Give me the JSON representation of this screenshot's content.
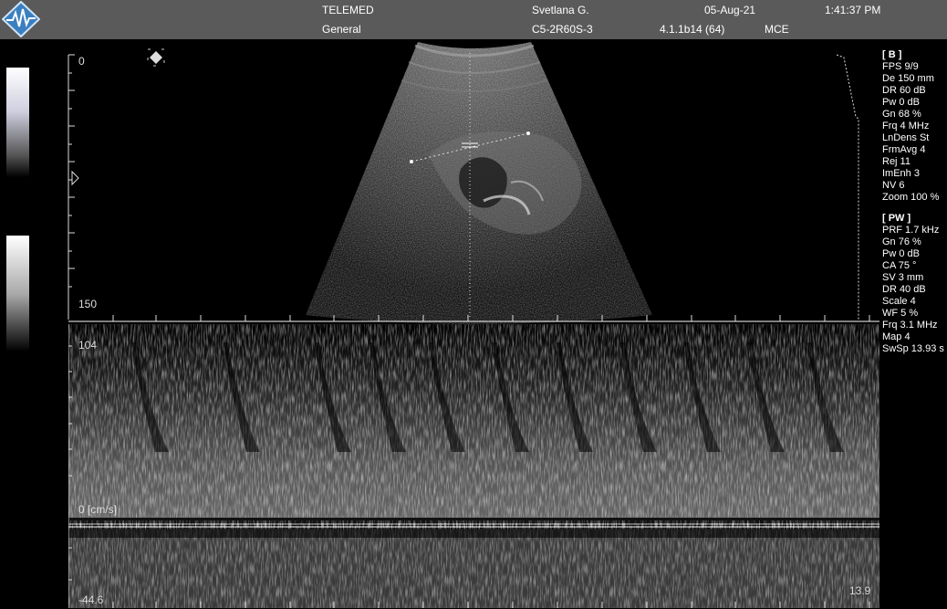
{
  "header": {
    "brand": "TELEMED",
    "preset": "General",
    "patient": "Svetlana G.",
    "probe": "C5-2R60S-3",
    "date": "05-Aug-21",
    "version": "4.1.1b14 (64)",
    "mode": "MCE",
    "time": "1:41:37 PM"
  },
  "bmode": {
    "depth_top": "0",
    "depth_bottom": "150"
  },
  "doppler": {
    "top_label": "104",
    "baseline_label": "0 [cm/s]",
    "bottom_label": "-44.6",
    "time_label": "13.9"
  },
  "b_params": {
    "title": "[ B ]",
    "items": [
      "FPS 9/9",
      "De 150 mm",
      "DR 60 dB",
      "Pw 0 dB",
      "Gn 68 %",
      "Frq 4 MHz",
      "LnDens St",
      "FrmAvg 4",
      "Rej 11",
      "ImEnh 3",
      "NV 6",
      "Zoom 100 %"
    ]
  },
  "pw_params": {
    "title": "[ PW ]",
    "items": [
      "PRF 1.7 kHz",
      "Gn 76 %",
      "Pw 0 dB",
      "CA 75 °",
      "SV 3 mm",
      "DR 40 dB",
      "Scale 4",
      "WF 5 %",
      "Frq 3.1 MHz",
      "Map 4",
      "SwSp 13.93 s"
    ]
  },
  "colors": {
    "topbar": "#5a5a5a",
    "background": "#000000",
    "text": "#ffffff"
  },
  "icons": [
    "telemed-logo-icon",
    "freeze-icon",
    "focus-marker-icon"
  ]
}
